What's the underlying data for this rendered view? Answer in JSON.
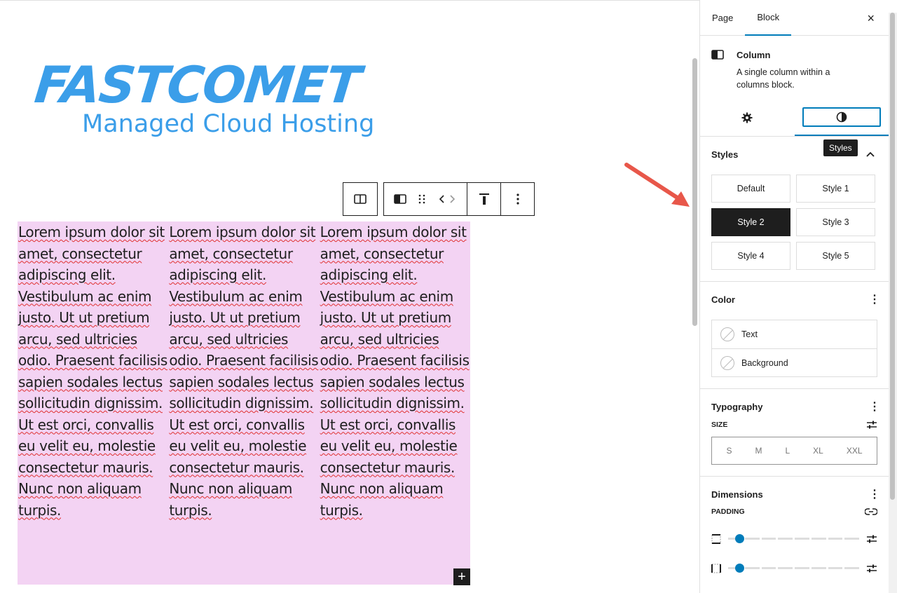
{
  "logo": {
    "main": "FASTCOMET",
    "sub": "Managed Cloud Hosting"
  },
  "columns_text": [
    "Lorem ipsum dolor sit amet, consectetur adipiscing elit. Vestibulum ac enim justo. Ut ut pretium arcu, sed ultricies odio. Praesent facilisis sapien sodales lectus sollicitudin dignissim. Ut est orci, convallis eu velit eu, molestie consectetur mauris. Nunc non aliquam turpis.",
    "Lorem ipsum dolor sit amet, consectetur adipiscing elit. Vestibulum ac enim justo. Ut ut pretium arcu, sed ultricies odio. Praesent facilisis sapien sodales lectus sollicitudin dignissim. Ut est orci, convallis eu velit eu, molestie consectetur mauris. Nunc non aliquam turpis.",
    "Lorem ipsum dolor sit amet, consectetur adipiscing elit. Vestibulum ac enim justo. Ut ut pretium arcu, sed ultricies odio. Praesent facilisis sapien sodales lectus sollicitudin dignissim. Ut est orci, convallis eu velit eu, molestie consectetur mauris. Nunc non aliquam turpis."
  ],
  "add_block_label": "+",
  "sidebar": {
    "tabs": [
      {
        "label": "Page"
      },
      {
        "label": "Block"
      }
    ],
    "close_label": "×",
    "block": {
      "title": "Column",
      "description": "A single column within a columns block."
    },
    "tooltip": "Styles",
    "styles": {
      "heading": "Styles",
      "options": [
        "Default",
        "Style 1",
        "Style 2",
        "Style 3",
        "Style 4",
        "Style 5"
      ],
      "selected": "Style 2"
    },
    "color": {
      "heading": "Color",
      "items": [
        "Text",
        "Background"
      ]
    },
    "typography": {
      "heading": "Typography",
      "size_label": "SIZE",
      "sizes": [
        "S",
        "M",
        "L",
        "XL",
        "XXL"
      ]
    },
    "dimensions": {
      "heading": "Dimensions",
      "padding_label": "PADDING"
    }
  },
  "colors": {
    "accent": "#007cba",
    "logo": "#3b9ee9",
    "column_bg": "#f3d3f3",
    "arrow": "#e8574a",
    "dark": "#1e1e1e"
  },
  "icons": [
    "columns-icon",
    "column-icon",
    "drag-handle-icon",
    "move-arrows-icon",
    "align-top-icon",
    "more-options-icon",
    "gear-icon",
    "half-circle-icon",
    "chevron-up-icon",
    "link-icon",
    "sliders-icon",
    "plus-icon",
    "close-icon"
  ]
}
